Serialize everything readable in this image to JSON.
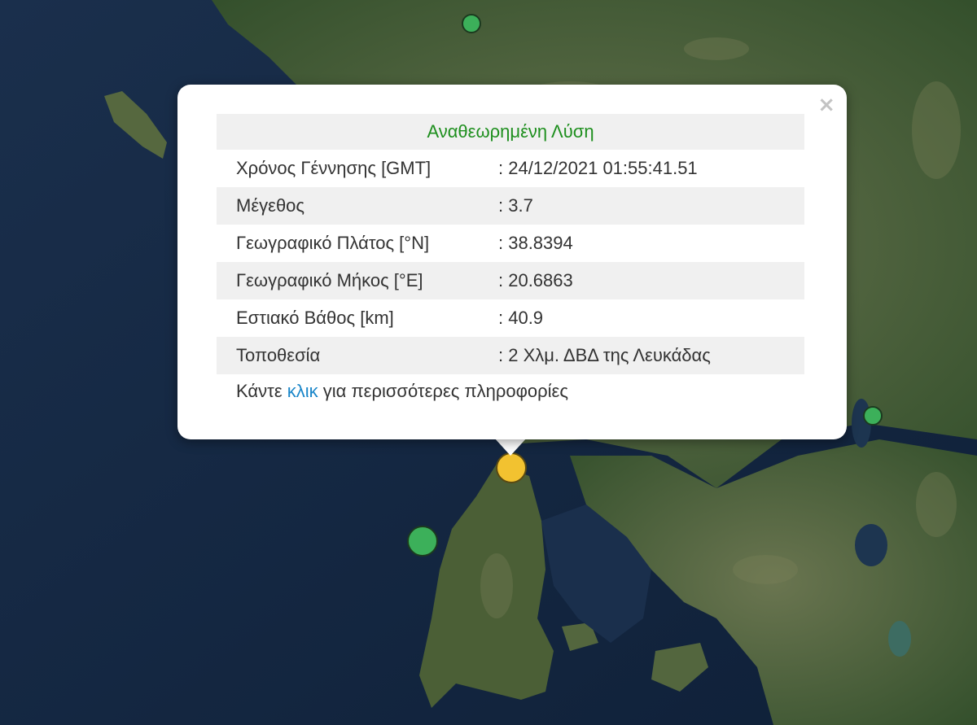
{
  "popup": {
    "title": "Αναθεωρημένη Λύση",
    "close_label": "×",
    "rows": [
      {
        "label": "Χρόνος Γέννησης [GMT]",
        "value": ": 24/12/2021 01:55:41.51"
      },
      {
        "label": "Μέγεθος",
        "value": ": 3.7"
      },
      {
        "label": "Γεωγραφικό Πλάτος [°N]",
        "value": ": 38.8394"
      },
      {
        "label": "Γεωγραφικό Μήκος [°E]",
        "value": ": 20.6863"
      },
      {
        "label": "Εστιακό Βάθος [km]",
        "value": ": 40.9"
      },
      {
        "label": "Τοποθεσία",
        "value": ": 2 Χλμ. ΔΒΔ της Λευκάδας"
      }
    ],
    "more_prefix": "Κάντε ",
    "more_link": "κλικ",
    "more_suffix": " για περισσότερες πληροφορίες"
  },
  "map": {
    "colors": {
      "sea": "#142742",
      "land": "#3f5a32",
      "land_light": "#5b6e45",
      "marker_recent": "#f2c230",
      "marker_older": "#3cb05a"
    }
  }
}
